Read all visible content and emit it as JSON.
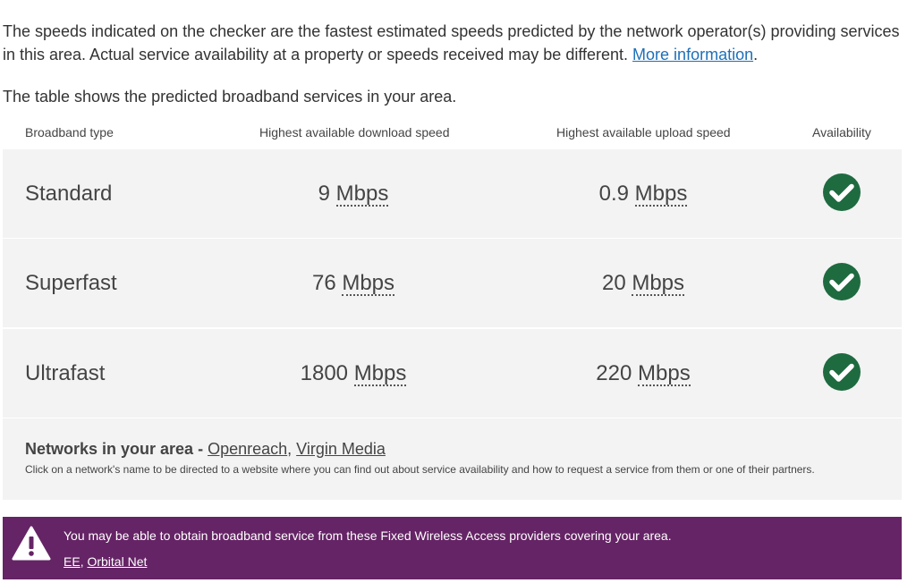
{
  "intro": {
    "text": "The speeds indicated on the checker are the fastest estimated speeds predicted by the network operator(s) providing services in this area. Actual service availability at a property or speeds received may be different.",
    "link": "More information",
    "after_link": "."
  },
  "table_intro": "The table shows the predicted broadband services in your area.",
  "columns": {
    "type": "Broadband type",
    "download": "Highest available download speed",
    "upload": "Highest available upload speed",
    "availability": "Availability"
  },
  "rows": [
    {
      "type": "Standard",
      "download_value": "9",
      "upload_value": "0.9",
      "unit": "Mbps",
      "available": true
    },
    {
      "type": "Superfast",
      "download_value": "76",
      "upload_value": "20",
      "unit": "Mbps",
      "available": true
    },
    {
      "type": "Ultrafast",
      "download_value": "1800",
      "upload_value": "220",
      "unit": "Mbps",
      "available": true
    }
  ],
  "networks": {
    "title": "Networks in your area",
    "separator": " - ",
    "links": [
      "Openreach",
      "Virgin Media"
    ],
    "note": "Click on a network's name to be directed to a website where you can find out about service availability and how to request a service from them or one of their partners."
  },
  "alert": {
    "text": "You may be able to obtain broadband service from these Fixed Wireless Access providers covering your area.",
    "links": [
      "EE",
      "Orbital Net"
    ]
  },
  "colors": {
    "link": "#1d70b8",
    "check": "#1e6b40",
    "alert_bg": "#652465",
    "row_bg": "#f3f3f3"
  },
  "icons": {
    "availability": "check-circle-icon",
    "alert": "warning-triangle-icon"
  }
}
